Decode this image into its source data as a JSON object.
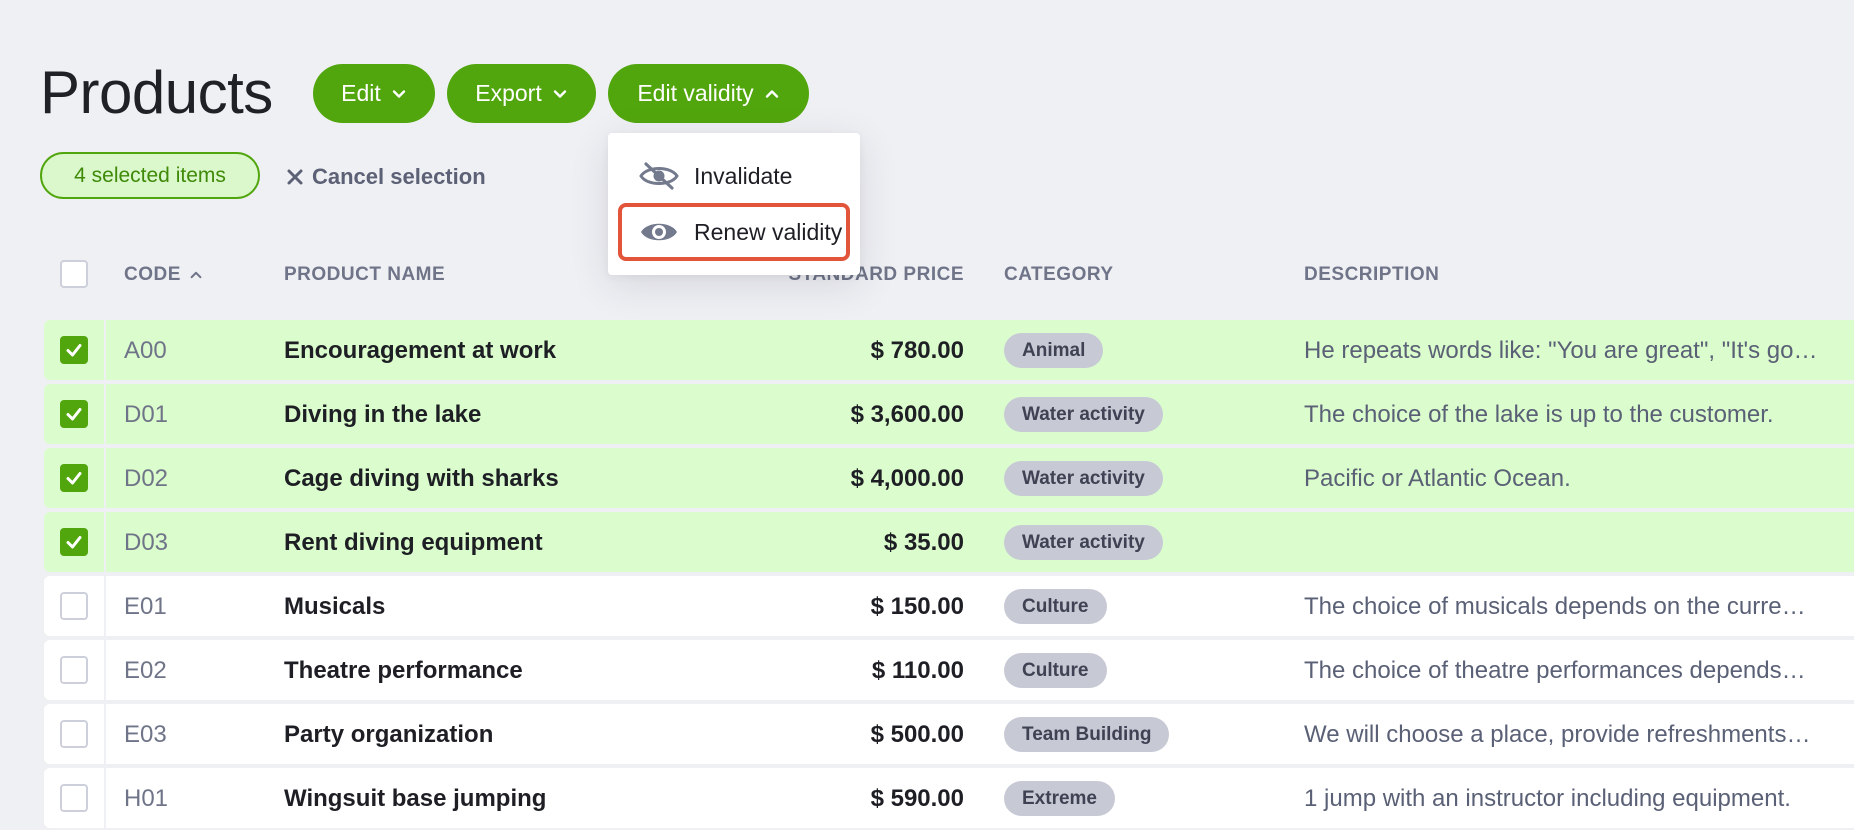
{
  "page": {
    "title": "Products"
  },
  "toolbar": {
    "edit_label": "Edit",
    "export_label": "Export",
    "validity_label": "Edit validity"
  },
  "selection": {
    "badge": "4 selected items",
    "cancel_label": "Cancel selection"
  },
  "validity_menu": {
    "items": [
      {
        "label": "Invalidate",
        "icon": "eye-off-icon"
      },
      {
        "label": "Renew validity",
        "icon": "eye-icon",
        "highlighted": true
      }
    ]
  },
  "table": {
    "columns": [
      "CODE",
      "PRODUCT NAME",
      "STANDARD PRICE",
      "CATEGORY",
      "DESCRIPTION"
    ],
    "sort": {
      "column": "CODE",
      "direction": "asc"
    },
    "rows": [
      {
        "selected": true,
        "code": "A00",
        "name": "Encouragement at work",
        "price": "$ 780.00",
        "category": "Animal",
        "description": "He repeats words like: \"You are great\", \"It's go…"
      },
      {
        "selected": true,
        "code": "D01",
        "name": "Diving in the lake",
        "price": "$ 3,600.00",
        "category": "Water activity",
        "description": "The choice of the lake is up to the customer."
      },
      {
        "selected": true,
        "code": "D02",
        "name": "Cage diving with sharks",
        "price": "$ 4,000.00",
        "category": "Water activity",
        "description": "Pacific or Atlantic Ocean."
      },
      {
        "selected": true,
        "code": "D03",
        "name": "Rent diving equipment",
        "price": "$ 35.00",
        "category": "Water activity",
        "description": ""
      },
      {
        "selected": false,
        "code": "E01",
        "name": "Musicals",
        "price": "$ 150.00",
        "category": "Culture",
        "description": "The choice of musicals depends on the curre…"
      },
      {
        "selected": false,
        "code": "E02",
        "name": "Theatre performance",
        "price": "$ 110.00",
        "category": "Culture",
        "description": "The choice of theatre performances depends…"
      },
      {
        "selected": false,
        "code": "E03",
        "name": "Party organization",
        "price": "$ 500.00",
        "category": "Team Building",
        "description": "We will choose a place, provide refreshments…"
      },
      {
        "selected": false,
        "code": "H01",
        "name": "Wingsuit base jumping",
        "price": "$ 590.00",
        "category": "Extreme",
        "description": "1 jump with an instructor including equipment."
      }
    ]
  },
  "colors": {
    "accent": "#52a60d",
    "selected_row": "#dbfccc",
    "highlight_border": "#e2553a",
    "background": "#eff0f4"
  }
}
